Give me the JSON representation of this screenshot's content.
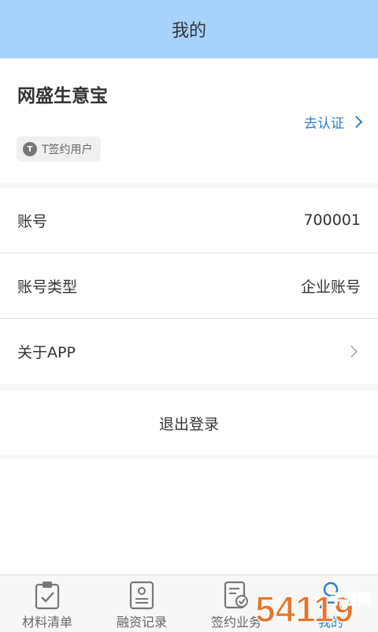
{
  "header": {
    "title": "我的"
  },
  "profile": {
    "company_name": "网盛生意宝",
    "verify_label": "去认证",
    "badge_icon": "T",
    "badge_label": "T签约用户"
  },
  "info_rows": [
    {
      "label": "账号",
      "value": "700001"
    },
    {
      "label": "账号类型",
      "value": "企业账号"
    },
    {
      "label": "关于APP",
      "value": ""
    }
  ],
  "logout_label": "退出登录",
  "tabbar": {
    "items": [
      {
        "label": "材料清单",
        "icon": "clipboard-check-icon"
      },
      {
        "label": "融资记录",
        "icon": "id-card-icon"
      },
      {
        "label": "签约业务",
        "icon": "contract-check-icon"
      },
      {
        "label": "我的",
        "icon": "user-icon"
      }
    ]
  },
  "watermark": {
    "brand": "54119",
    "site": "手游网"
  },
  "colors": {
    "header_bg": "#a6d2fb",
    "accent": "#2a7fd4",
    "watermark": "#e8752b"
  }
}
